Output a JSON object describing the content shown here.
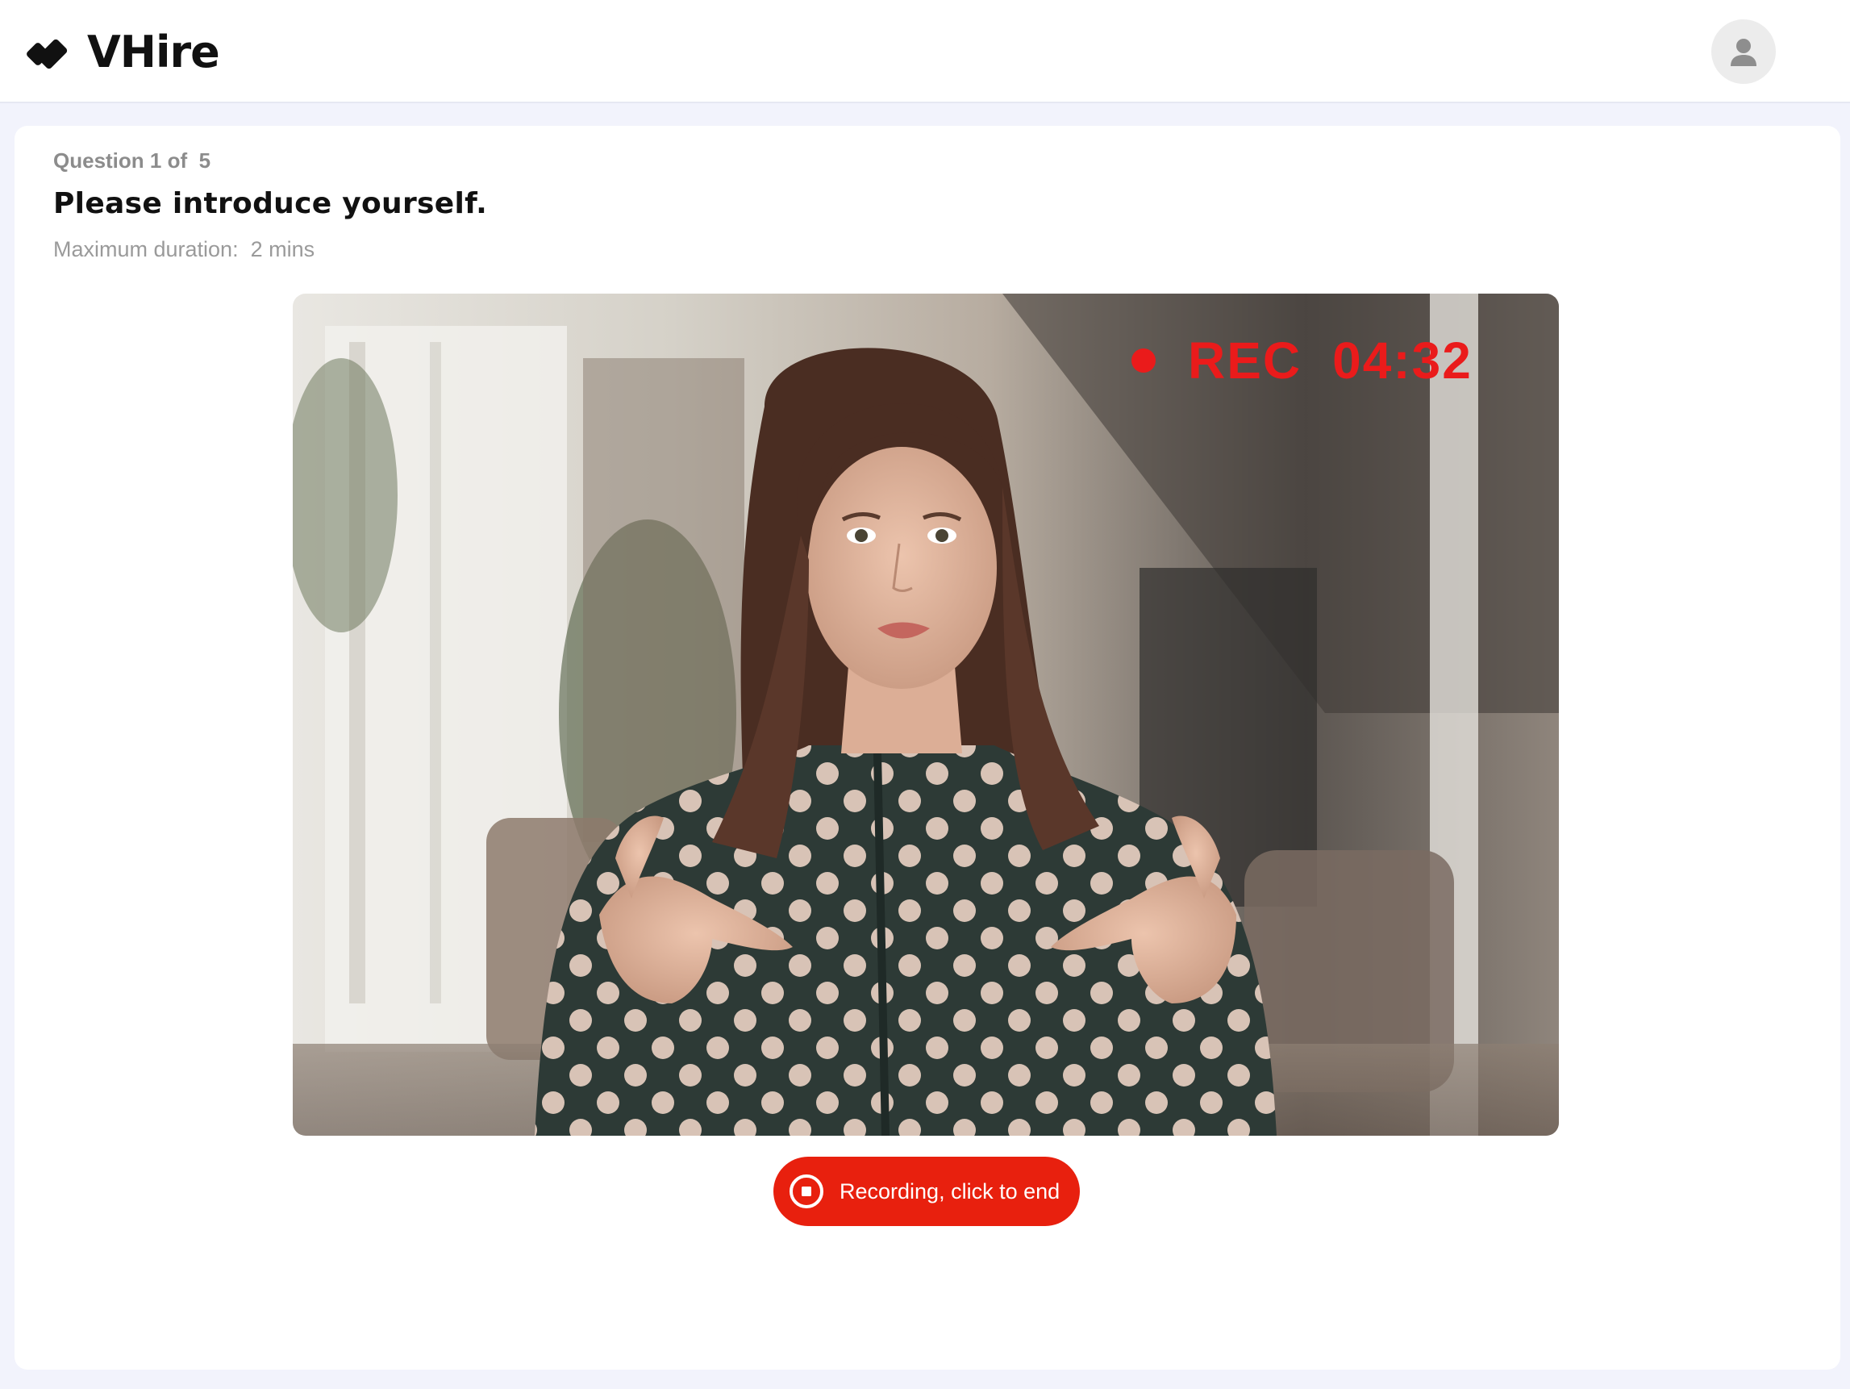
{
  "header": {
    "brand": "VHire",
    "logo_icon": "vhire-logo-mark",
    "avatar_icon": "user-icon"
  },
  "question": {
    "counter": "Question 1 of  5",
    "title": "Please introduce yourself.",
    "duration": "Maximum duration:  2 mins"
  },
  "video": {
    "rec_label": "REC",
    "rec_time": "04:32",
    "rec_color": "#ea1b1b"
  },
  "record_button": {
    "label": "Recording, click to end",
    "icon": "stop-icon",
    "color": "#e8200e"
  }
}
